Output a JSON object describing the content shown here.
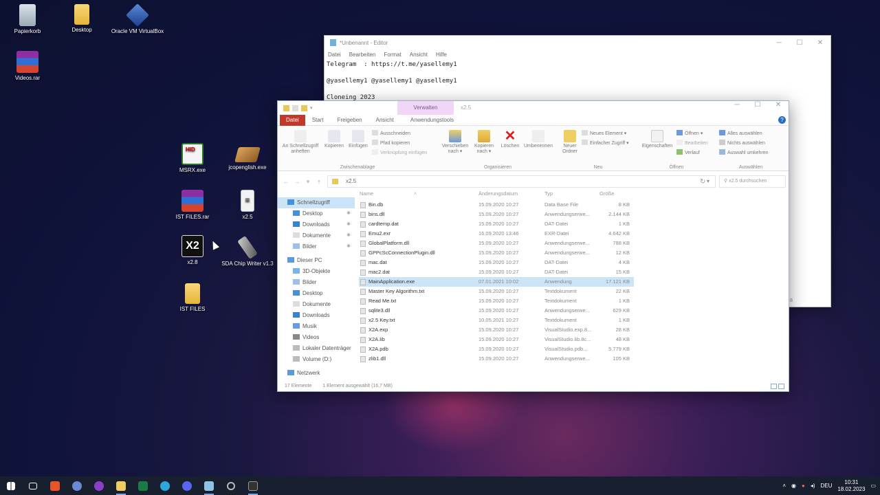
{
  "desktop": {
    "icons": [
      {
        "label": "Papierkorb",
        "icon": "recycle-bin-icon"
      },
      {
        "label": "Desktop",
        "icon": "folder-icon"
      },
      {
        "label": "Oracle VM VirtualBox",
        "icon": "virtualbox-icon"
      },
      {
        "label": "Videos.rar",
        "icon": "winrar-icon"
      },
      {
        "label": "MSRX.exe",
        "icon": "msrx-app-icon"
      },
      {
        "label": "jcopenglish.exe",
        "icon": "jcop-app-icon"
      },
      {
        "label": "IST FILES.rar",
        "icon": "winrar-icon"
      },
      {
        "label": "x2.5",
        "icon": "file-icon"
      },
      {
        "label": "x2.8",
        "icon": "x2-app-icon"
      },
      {
        "label": "SDA Chip Writer v1.3",
        "icon": "usb-tool-icon"
      },
      {
        "label": "IST FILES",
        "icon": "folder-icon"
      }
    ]
  },
  "notepad": {
    "title": "*Unbenannt - Editor",
    "menu": [
      "Datei",
      "Bearbeiten",
      "Format",
      "Ansicht",
      "Hilfe"
    ],
    "lines": [
      "Telegram  : https://t.me/yasellemy1",
      "",
      "@yasellemy1 @yasellemy1 @yasellemy1",
      "",
      "Cloneing 2023"
    ],
    "status_fragment": "8"
  },
  "explorer": {
    "window_name": "x2.5",
    "context_tab": "Verwalten",
    "tabs": [
      "Datei",
      "Start",
      "Freigeben",
      "Ansicht",
      "Anwendungstools"
    ],
    "ribbon": {
      "clipboard": {
        "label": "Zwischenablage",
        "pin": "An Schnellzugriff anheften",
        "copy": "Kopieren",
        "paste": "Einfügen",
        "cut": "Ausschneiden",
        "copy_path": "Pfad kopieren",
        "paste_shortcut": "Verknüpfung einfügen"
      },
      "organize": {
        "label": "Organisieren",
        "move_to": "Verschieben nach",
        "copy_to": "Kopieren nach",
        "delete": "Löschen",
        "rename": "Umbenennen"
      },
      "new": {
        "label": "Neu",
        "new_folder": "Neuer Ordner",
        "new_item": "Neues Element",
        "easy_access": "Einfacher Zugriff"
      },
      "open": {
        "label": "Öffnen",
        "properties": "Eigenschaften",
        "open": "Öffnen",
        "edit": "Bearbeiten",
        "history": "Verlauf"
      },
      "select": {
        "label": "Auswählen",
        "select_all": "Alles auswählen",
        "select_none": "Nichts auswählen",
        "invert": "Auswahl umkehren"
      }
    },
    "address": "x2.5",
    "search_placeholder": "x2.5 durchsuchen",
    "nav": [
      {
        "label": "Schnellzugriff",
        "pinned": false,
        "selected": true
      },
      {
        "label": "Desktop",
        "pinned": true
      },
      {
        "label": "Downloads",
        "pinned": true
      },
      {
        "label": "Dokumente",
        "pinned": true
      },
      {
        "label": "Bilder",
        "pinned": true
      },
      {
        "label": "Dieser PC"
      },
      {
        "label": "3D-Objekte"
      },
      {
        "label": "Bilder"
      },
      {
        "label": "Desktop"
      },
      {
        "label": "Dokumente"
      },
      {
        "label": "Downloads"
      },
      {
        "label": "Musik"
      },
      {
        "label": "Videos"
      },
      {
        "label": "Lokaler Datenträger"
      },
      {
        "label": "Volume (D:)"
      },
      {
        "label": "Netzwerk"
      }
    ],
    "columns": [
      "Name",
      "Änderungsdatum",
      "Typ",
      "Größe"
    ],
    "files": [
      {
        "name": "Bin.db",
        "date": "15.09.2020 10:27",
        "type": "Data Base File",
        "size": "8 KB"
      },
      {
        "name": "bins.dll",
        "date": "15.09.2020 10:27",
        "type": "Anwendungserwe...",
        "size": "2.144 KB"
      },
      {
        "name": "cardtemp.dat",
        "date": "15.09.2020 10:27",
        "type": "DAT-Datei",
        "size": "1 KB"
      },
      {
        "name": "Emu2.exr",
        "date": "16.09.2020 13:46",
        "type": "EXR-Datei",
        "size": "4.642 KB"
      },
      {
        "name": "GlobalPlatform.dll",
        "date": "15.09.2020 10:27",
        "type": "Anwendungserwe...",
        "size": "788 KB"
      },
      {
        "name": "GPPcScConnectionPlugin.dll",
        "date": "15.09.2020 10:27",
        "type": "Anwendungserwe...",
        "size": "12 KB"
      },
      {
        "name": "mac.dat",
        "date": "15.09.2020 10:27",
        "type": "DAT-Datei",
        "size": "4 KB"
      },
      {
        "name": "mac2.dat",
        "date": "15.09.2020 10:27",
        "type": "DAT-Datei",
        "size": "15 KB"
      },
      {
        "name": "MainApplication.exe",
        "date": "07.01.2021 10:02",
        "type": "Anwendung",
        "size": "17.121 KB",
        "selected": true
      },
      {
        "name": "Master Key Algorithm.txt",
        "date": "15.09.2020 10:27",
        "type": "Textdokument",
        "size": "22 KB"
      },
      {
        "name": "Read Me.txt",
        "date": "15.09.2020 10:27",
        "type": "Textdokument",
        "size": "1 KB"
      },
      {
        "name": "sqlite3.dll",
        "date": "15.09.2020 10:27",
        "type": "Anwendungserwe...",
        "size": "629 KB"
      },
      {
        "name": "x2.5 Key.txt",
        "date": "10.05.2021 10:27",
        "type": "Textdokument",
        "size": "1 KB"
      },
      {
        "name": "X2A.exp",
        "date": "15.09.2020 10:27",
        "type": "VisualStudio.exp.8...",
        "size": "28 KB"
      },
      {
        "name": "X2A.lib",
        "date": "15.09.2020 10:27",
        "type": "VisualStudio.lib.8c...",
        "size": "48 KB"
      },
      {
        "name": "X2A.pdb",
        "date": "15.09.2020 10:27",
        "type": "VisualStudio.pdb...",
        "size": "5.779 KB"
      },
      {
        "name": "zlib1.dll",
        "date": "15.09.2020 10:27",
        "type": "Anwendungserwe...",
        "size": "105 KB"
      }
    ],
    "status_count": "17 Elemente",
    "status_selected": "1 Element ausgewählt (16,7 MB)"
  },
  "taskbar": {
    "icons": [
      "windows-start-icon",
      "task-view-icon",
      "brave-browser-icon",
      "cortana-icon",
      "tor-browser-icon",
      "file-explorer-icon",
      "excel-icon",
      "telegram-icon",
      "discord-icon",
      "notepad-icon",
      "update-icon",
      "app-icon"
    ],
    "language": "DEU",
    "time": "10:31",
    "date": "18.02.2023"
  },
  "colors": {
    "accent": "#c0392b",
    "selection": "#cce4f7",
    "taskbar": "#181f2e",
    "manage_tab": "#f1d6f7"
  }
}
